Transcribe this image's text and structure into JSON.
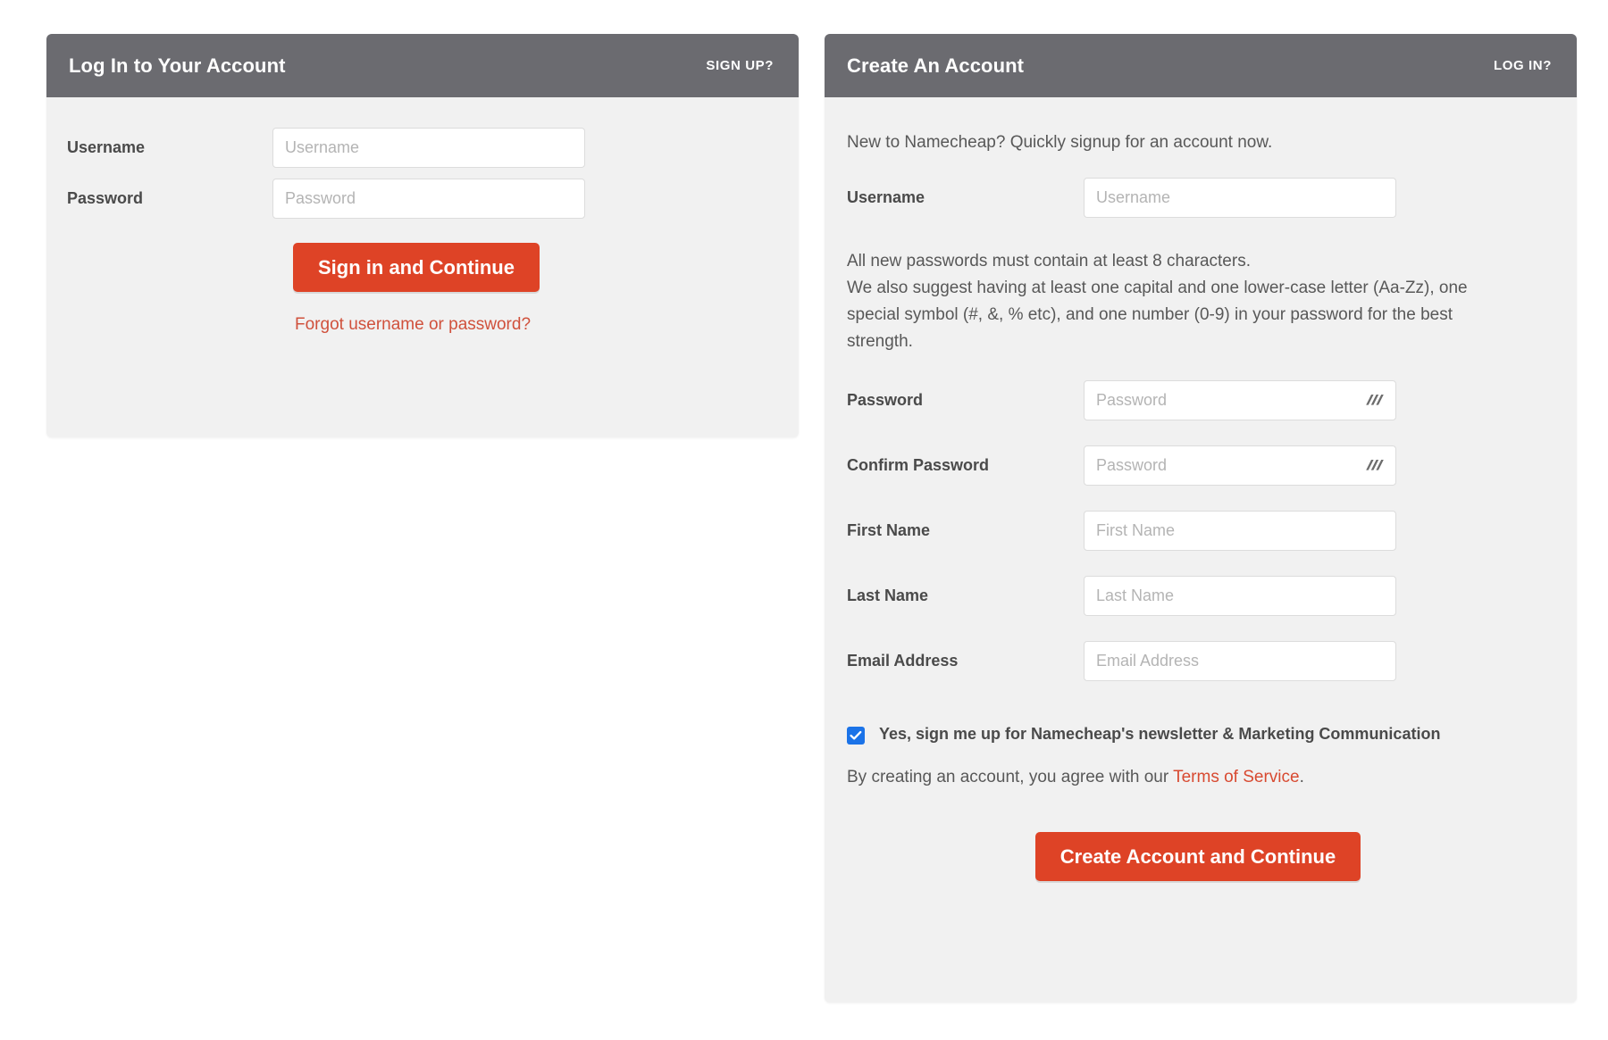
{
  "login": {
    "header": {
      "title": "Log In to Your Account",
      "switch_link": "SIGN UP?"
    },
    "fields": [
      {
        "label": "Username",
        "placeholder": "Username",
        "value": ""
      },
      {
        "label": "Password",
        "placeholder": "Password",
        "value": ""
      }
    ],
    "submit_label": "Sign in and Continue",
    "forgot_link": "Forgot username or password?"
  },
  "signup": {
    "header": {
      "title": "Create An Account",
      "switch_link": "LOG IN?"
    },
    "intro": "New to Namecheap? Quickly signup for an account now.",
    "username": {
      "label": "Username",
      "placeholder": "Username",
      "value": ""
    },
    "password_note_line1": "All new passwords must contain at least 8 characters.",
    "password_note_line2": "We also suggest having at least one capital and one lower-case letter (Aa-Zz), one special symbol (#, &, % etc), and one number (0-9) in your password for the best strength.",
    "fields": [
      {
        "label": "Password",
        "placeholder": "Password",
        "value": "",
        "icon": "eye-slash-icon"
      },
      {
        "label": "Confirm Password",
        "placeholder": "Password",
        "value": "",
        "icon": "eye-slash-icon"
      },
      {
        "label": "First Name",
        "placeholder": "First Name",
        "value": ""
      },
      {
        "label": "Last Name",
        "placeholder": "Last Name",
        "value": ""
      },
      {
        "label": "Email Address",
        "placeholder": "Email Address",
        "value": ""
      }
    ],
    "newsletter": {
      "checked": true,
      "label": "Yes, sign me up for Namecheap's newsletter & Marketing Communication"
    },
    "terms_prefix": "By creating an account, you agree with our ",
    "terms_link": "Terms of Service",
    "terms_suffix": ".",
    "submit_label": "Create Account and Continue"
  },
  "colors": {
    "header_gray": "#6b6b70",
    "panel_bg": "#f1f1f1",
    "accent_red": "#de4326",
    "link_red": "#d0513c",
    "checkbox_blue": "#1b73e8",
    "page_bg": "#ffffff"
  }
}
